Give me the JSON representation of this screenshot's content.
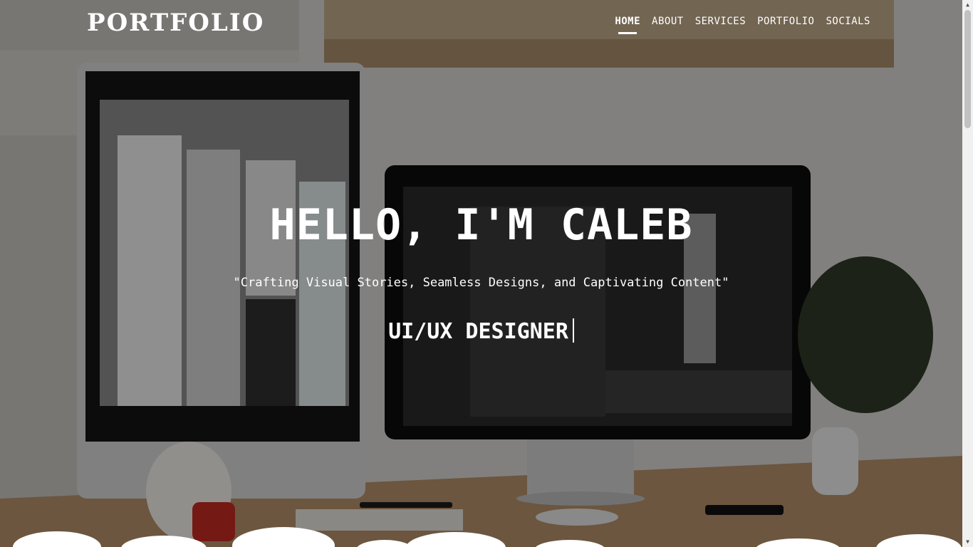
{
  "header": {
    "logo": "PORTFOLIO",
    "nav": [
      {
        "label": "HOME",
        "active": true
      },
      {
        "label": "ABOUT",
        "active": false
      },
      {
        "label": "SERVICES",
        "active": false
      },
      {
        "label": "PORTFOLIO",
        "active": false
      },
      {
        "label": "SOCIALS",
        "active": false
      }
    ]
  },
  "hero": {
    "title": "HELLO, I'M CALEB",
    "tagline": "\"Crafting Visual Stories, Seamless Designs, and Captivating Content\"",
    "role": "UI/UX DESIGNER"
  },
  "colors": {
    "text": "#ffffff",
    "overlay": "rgba(0,0,0,0.40)",
    "wall": "#d9d6d2",
    "desk": "#b58f6a"
  },
  "icons": {
    "scroll_up": "chevron-up-icon",
    "scroll_down": "chevron-down-icon"
  }
}
